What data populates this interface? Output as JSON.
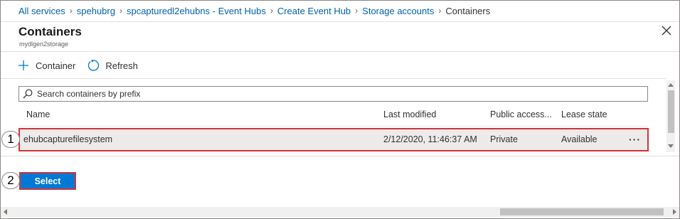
{
  "breadcrumb": [
    {
      "label": "All services"
    },
    {
      "label": "spehubrg"
    },
    {
      "label": "spcapturedl2ehubns - Event Hubs"
    },
    {
      "label": "Create Event Hub"
    },
    {
      "label": "Storage accounts"
    },
    {
      "label": "Containers"
    }
  ],
  "blade": {
    "title": "Containers",
    "subtitle": "mydlgen2storage"
  },
  "toolbar": {
    "container_label": "Container",
    "refresh_label": "Refresh"
  },
  "search": {
    "placeholder": "Search containers by prefix",
    "value": ""
  },
  "table": {
    "columns": [
      "Name",
      "Last modified",
      "Public access...",
      "Lease state"
    ],
    "rows": [
      {
        "name": "ehubcapturefilesystem",
        "last_modified": "2/12/2020, 11:46:37 AM",
        "public_access": "Private",
        "lease_state": "Available",
        "more": "···"
      }
    ]
  },
  "footer": {
    "select_label": "Select"
  },
  "callouts": [
    "1",
    "2"
  ],
  "colors": {
    "link": "#0062ad",
    "accent": "#0078d4",
    "highlight_border": "#d13438",
    "selected_row": "#edebe9"
  },
  "icons": {
    "close": "close-icon",
    "add": "plus-icon",
    "refresh": "refresh-icon",
    "search": "search-icon",
    "more": "more-icon"
  }
}
